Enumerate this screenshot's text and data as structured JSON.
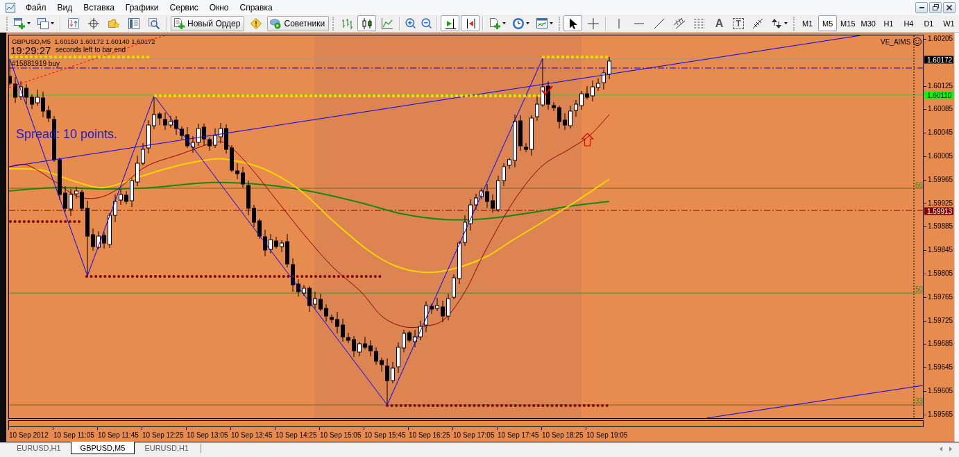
{
  "menu": {
    "items": [
      "Файл",
      "Вид",
      "Вставка",
      "Графики",
      "Сервис",
      "Окно",
      "Справка"
    ]
  },
  "toolbar": {
    "new_order": "Новый Ордер",
    "experts": "Советники",
    "chart_types": [
      {
        "selected": false
      },
      {
        "selected": true
      },
      {
        "selected": false
      }
    ],
    "auto_scroll": {
      "on": true
    },
    "chart_shift": {
      "on": true
    },
    "cursor_modes": [
      {
        "selected": true
      },
      {
        "selected": false
      }
    ],
    "text_tool": "A",
    "label_tool": "T",
    "timeframes": [
      {
        "label": "M1",
        "selected": false
      },
      {
        "label": "M5",
        "selected": true
      },
      {
        "label": "M15",
        "selected": false
      },
      {
        "label": "M30",
        "selected": false
      },
      {
        "label": "H1",
        "selected": false
      },
      {
        "label": "H4",
        "selected": false
      },
      {
        "label": "D1",
        "selected": false
      },
      {
        "label": "W1",
        "selected": false
      }
    ]
  },
  "chart": {
    "header": "GBPUSD,M5  1.60150 1.60172 1.60140 1.60172",
    "clock": "19:29:27",
    "timer_caption": "seconds left to bar end",
    "order_label": "#15881919 buy",
    "spread": "Spread: 10 points.",
    "indicator_name": "VE_AIMS",
    "level_labels": [
      "66",
      "50",
      "33"
    ],
    "price_ticks": [
      "1.60205",
      "1.60125",
      "1.60085",
      "1.60045",
      "1.60005",
      "1.59965",
      "1.59925",
      "1.59885",
      "1.59845",
      "1.59805",
      "1.59765",
      "1.59725",
      "1.59685",
      "1.59645",
      "1.59605",
      "1.59565"
    ],
    "price_badges": [
      {
        "text": "1.60172",
        "color": "#000000"
      },
      {
        "text": "1.60110",
        "color": "#00ff00"
      },
      {
        "text": "1.59913",
        "color": "#800000"
      }
    ],
    "time_ticks": [
      "10 Sep 2012",
      "10 Sep 11:05",
      "10 Sep 11:45",
      "10 Sep 12:25",
      "10 Sep 13:05",
      "10 Sep 13:45",
      "10 Sep 14:25",
      "10 Sep 15:05",
      "10 Sep 15:45",
      "10 Sep 16:25",
      "10 Sep 17:05",
      "10 Sep 17:45",
      "10 Sep 18:25",
      "10 Sep 19:05"
    ]
  },
  "tabs": [
    {
      "label": "EURUSD,H1",
      "selected": false
    },
    {
      "label": "GBPUSD,M5",
      "selected": true
    },
    {
      "label": "EURUSD,H1",
      "selected": false
    }
  ]
}
